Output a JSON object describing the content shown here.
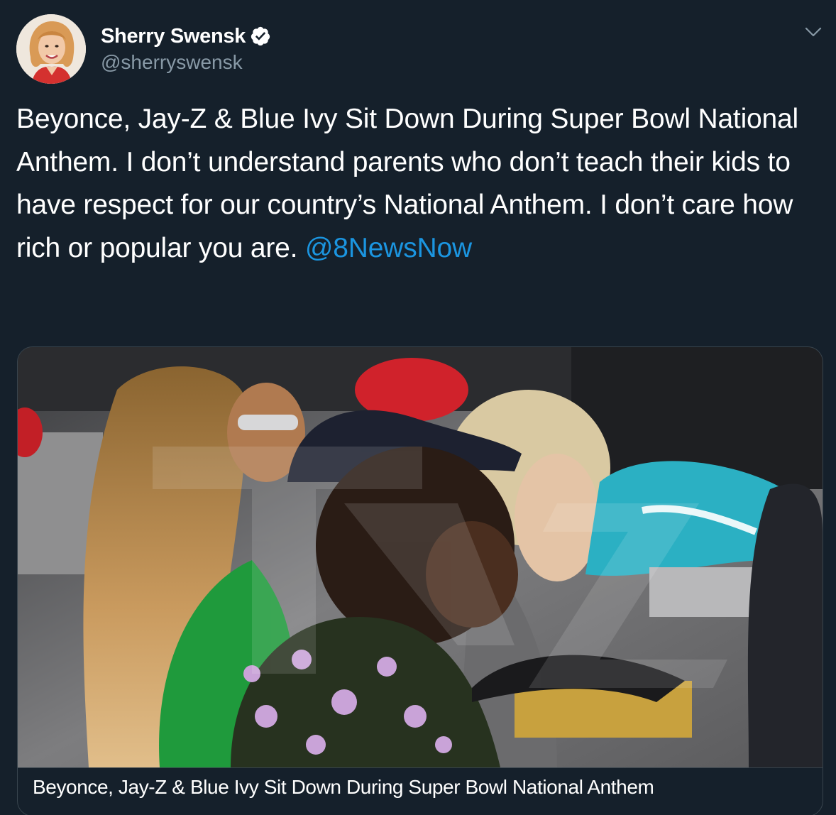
{
  "user": {
    "display_name": "Sherry Swensk",
    "handle": "@sherryswensk",
    "verified": true,
    "avatar_icon": "profile-photo"
  },
  "tweet": {
    "text": "Beyonce, Jay-Z & Blue Ivy Sit Down During Super Bowl National Anthem. I don’t understand parents who don’t teach their kids to have respect for our country’s National Anthem. I don’t care how rich or popular you are.",
    "mention": "@8NewsNow"
  },
  "media": {
    "caption": "Beyonce, Jay-Z & Blue Ivy Sit Down During Super Bowl National Anthem"
  },
  "colors": {
    "background": "#15202b",
    "link": "#1b95e0",
    "secondary_text": "#8899a6",
    "border": "#38444d",
    "verified_badge": "#ffffff"
  },
  "icons": [
    "verified-badge-icon",
    "chevron-down-icon"
  ]
}
